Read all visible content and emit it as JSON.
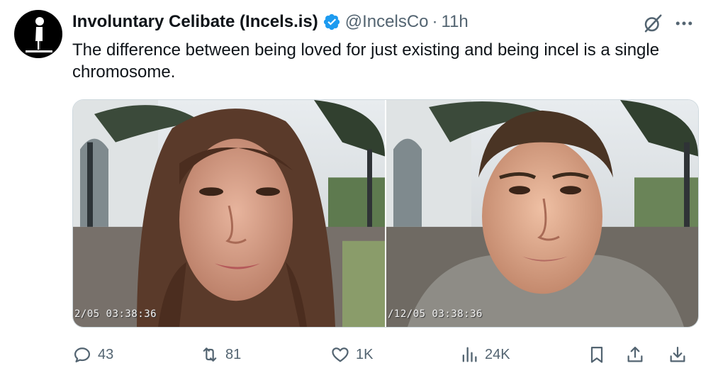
{
  "tweet": {
    "author_name": "Involuntary Celibate (Incels.is)",
    "handle": "@IncelsCo",
    "separator": "·",
    "time": "11h",
    "text": "The difference between being loved for just existing and being incel is a single chromosome.",
    "verified_color": "#1d9bf0",
    "avatar_icon": "standing-figure-icon"
  },
  "media": {
    "photo_left": {
      "timestamp": "2/05  03:38:36"
    },
    "photo_right": {
      "timestamp": "/12/05  03:38:36"
    }
  },
  "actions": {
    "reply": {
      "count": "43",
      "icon": "reply-icon"
    },
    "retweet": {
      "count": "81",
      "icon": "retweet-icon"
    },
    "like": {
      "count": "1K",
      "icon": "heart-icon"
    },
    "views": {
      "count": "24K",
      "icon": "analytics-icon"
    },
    "bookmark": {
      "icon": "bookmark-icon"
    },
    "share": {
      "icon": "share-icon"
    },
    "download": {
      "icon": "download-icon"
    }
  },
  "colors": {
    "text": "#0f1419",
    "muted": "#536471",
    "accent": "#1d9bf0"
  }
}
